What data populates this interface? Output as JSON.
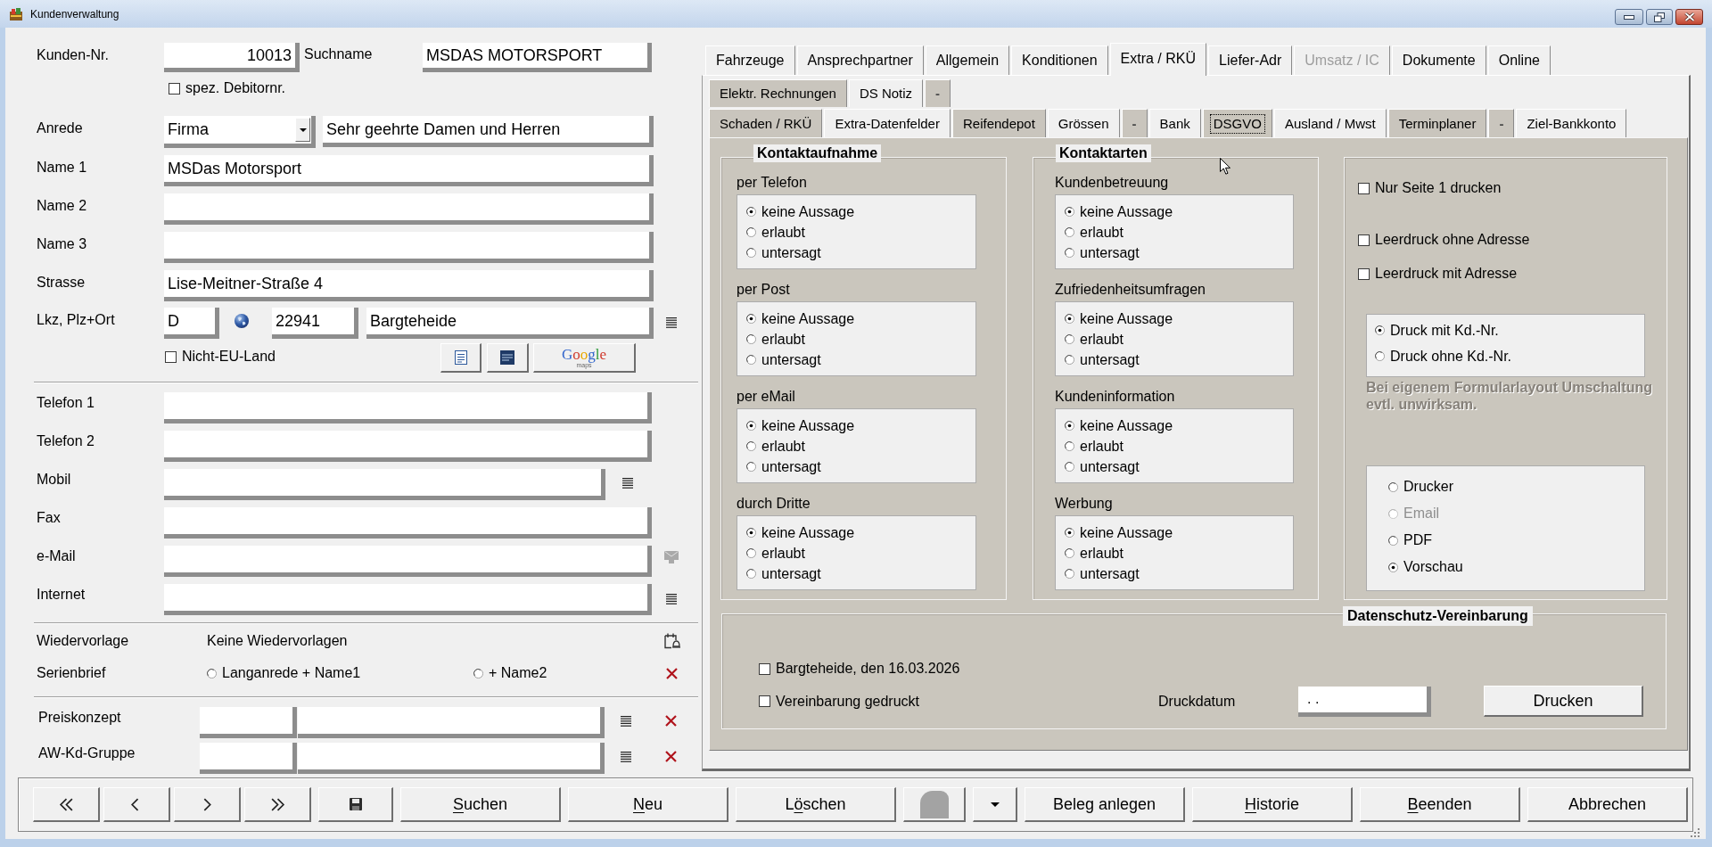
{
  "window": {
    "title": "Kundenverwaltung"
  },
  "customer": {
    "number": {
      "label": "Kunden-Nr.",
      "value": "10013"
    },
    "search_name": {
      "label": "Suchname",
      "value": "MSDAS MOTORSPORT"
    },
    "special_debtor": {
      "label": "spez. Debitornr.",
      "checked": false
    },
    "salutation": {
      "label": "Anrede",
      "value": "Firma",
      "greeting": "Sehr geehrte Damen und Herren"
    },
    "names": [
      {
        "label": "Name 1",
        "value": "MSDas Motorsport"
      },
      {
        "label": "Name 2"
      },
      {
        "label": "Name 3"
      }
    ],
    "street": {
      "label": "Strasse",
      "value": "Lise-Meitner-Straße 4"
    },
    "location": {
      "label": "Lkz, Plz+Ort",
      "country": "D",
      "zip": "22941",
      "city": "Bargteheide"
    },
    "non_eu": {
      "label": "Nicht-EU-Land",
      "checked": false
    },
    "maps_button": {
      "label": "Google",
      "sublabel": "maps"
    },
    "contacts": [
      {
        "label": "Telefon 1",
        "kind": "plain"
      },
      {
        "label": "Telefon 2",
        "kind": "plain"
      },
      {
        "label": "Mobil",
        "kind": "list-short"
      },
      {
        "label": "Fax",
        "kind": "plain"
      },
      {
        "label": "e-Mail",
        "kind": "mail"
      },
      {
        "label": "Internet",
        "kind": "list"
      }
    ],
    "follow_up": {
      "label": "Wiedervorlage",
      "value": "Keine Wiedervorlagen"
    },
    "serial_letter": {
      "label": "Serienbrief",
      "options": [
        {
          "label": "Langanrede + Name1",
          "selected": false
        },
        {
          "label": "+ Name2",
          "selected": false
        }
      ]
    },
    "lookups": [
      {
        "label": "Preiskonzept"
      },
      {
        "label": "AW-Kd-Gruppe"
      }
    ]
  },
  "tabs": [
    {
      "label": "Fahrzeuge",
      "selected": false,
      "disabled": false
    },
    {
      "label": "Ansprechpartner",
      "selected": false,
      "disabled": false
    },
    {
      "label": "Allgemein",
      "selected": false,
      "disabled": false
    },
    {
      "label": "Konditionen",
      "selected": false,
      "disabled": false
    },
    {
      "label": "Extra / RKÜ",
      "selected": true,
      "disabled": false
    },
    {
      "label": "Liefer-Adr",
      "selected": false,
      "disabled": false
    },
    {
      "label": "Umsatz / IC",
      "selected": false,
      "disabled": true
    },
    {
      "label": "Dokumente",
      "selected": false,
      "disabled": false
    },
    {
      "label": "Online",
      "selected": false,
      "disabled": false
    }
  ],
  "sub_tab_rows": [
    {
      "tabs": [
        {
          "label": "Elektr. Rechnungen",
          "selected": false,
          "highlighted": true,
          "disabled": false
        },
        {
          "label": "DS Notiz",
          "selected": false,
          "highlighted": false,
          "disabled": false
        },
        {
          "label": "-",
          "selected": false,
          "highlighted": true,
          "disabled": true
        }
      ]
    },
    {
      "tabs": [
        {
          "label": "Schaden / RKÜ",
          "selected": false,
          "highlighted": true,
          "disabled": false
        },
        {
          "label": "Extra-Datenfelder",
          "selected": false,
          "highlighted": false,
          "disabled": false
        },
        {
          "label": "Reifendepot",
          "selected": false,
          "highlighted": true,
          "disabled": false
        },
        {
          "label": "Grössen",
          "selected": false,
          "highlighted": false,
          "disabled": false
        },
        {
          "label": "-",
          "selected": false,
          "highlighted": true,
          "disabled": true
        },
        {
          "label": "Bank",
          "selected": false,
          "highlighted": false,
          "disabled": false
        },
        {
          "label": "DSGVO",
          "selected": true,
          "highlighted": false,
          "disabled": false
        },
        {
          "label": "Ausland / Mwst",
          "selected": false,
          "highlighted": false,
          "disabled": false
        },
        {
          "label": "Terminplaner",
          "selected": false,
          "highlighted": true,
          "disabled": false
        },
        {
          "label": "-",
          "selected": false,
          "highlighted": true,
          "disabled": true
        },
        {
          "label": "Ziel-Bankkonto",
          "selected": false,
          "highlighted": false,
          "disabled": false
        }
      ]
    }
  ],
  "dsgvo": {
    "contact_groups": [
      {
        "title": "Kontaktaufnahme",
        "sections": [
          {
            "label": "per Telefon",
            "options": [
              {
                "label": "keine Aussage",
                "selected": true
              },
              {
                "label": "erlaubt",
                "selected": false
              },
              {
                "label": "untersagt",
                "selected": false
              }
            ]
          },
          {
            "label": "per Post",
            "options": [
              {
                "label": "keine Aussage",
                "selected": true
              },
              {
                "label": "erlaubt",
                "selected": false
              },
              {
                "label": "untersagt",
                "selected": false
              }
            ]
          },
          {
            "label": "per eMail",
            "options": [
              {
                "label": "keine Aussage",
                "selected": true
              },
              {
                "label": "erlaubt",
                "selected": false
              },
              {
                "label": "untersagt",
                "selected": false
              }
            ]
          },
          {
            "label": "durch Dritte",
            "options": [
              {
                "label": "keine Aussage",
                "selected": true
              },
              {
                "label": "erlaubt",
                "selected": false
              },
              {
                "label": "untersagt",
                "selected": false
              }
            ]
          }
        ]
      },
      {
        "title": "Kontaktarten",
        "sections": [
          {
            "label": "Kundenbetreuung",
            "options": [
              {
                "label": "keine Aussage",
                "selected": true
              },
              {
                "label": "erlaubt",
                "selected": false
              },
              {
                "label": "untersagt",
                "selected": false
              }
            ]
          },
          {
            "label": "Zufriedenheitsumfragen",
            "options": [
              {
                "label": "keine Aussage",
                "selected": true
              },
              {
                "label": "erlaubt",
                "selected": false
              },
              {
                "label": "untersagt",
                "selected": false
              }
            ]
          },
          {
            "label": "Kundeninformation",
            "options": [
              {
                "label": "keine Aussage",
                "selected": true
              },
              {
                "label": "erlaubt",
                "selected": false
              },
              {
                "label": "untersagt",
                "selected": false
              }
            ]
          },
          {
            "label": "Werbung",
            "options": [
              {
                "label": "keine Aussage",
                "selected": true
              },
              {
                "label": "erlaubt",
                "selected": false
              },
              {
                "label": "untersagt",
                "selected": false
              }
            ]
          }
        ]
      }
    ],
    "print_options": {
      "checkboxes": [
        {
          "label": "Nur Seite 1 drucken",
          "checked": false
        },
        {
          "label": "Leerdruck ohne Adresse",
          "checked": false
        },
        {
          "label": "Leerdruck mit Adresse",
          "checked": false
        }
      ],
      "number_options": [
        {
          "label": "Druck mit Kd.-Nr.",
          "selected": true
        },
        {
          "label": "Druck ohne Kd.-Nr.",
          "selected": false
        }
      ],
      "note": "Bei eigenem Formularlayout Umschaltung evtl. unwirksam.",
      "output_options": [
        {
          "label": "Drucker",
          "selected": false,
          "disabled": false
        },
        {
          "label": "Email",
          "selected": false,
          "disabled": true
        },
        {
          "label": "PDF",
          "selected": false,
          "disabled": false
        },
        {
          "label": "Vorschau",
          "selected": true,
          "disabled": false
        }
      ]
    },
    "agreement": {
      "title": "Datenschutz-Vereinbarung",
      "checkboxes": [
        {
          "label": "Bargteheide, den 16.03.2026",
          "checked": false
        },
        {
          "label": "Vereinbarung gedruckt",
          "checked": false
        }
      ],
      "print_date_label": "Druckdatum",
      "print_date": ". .",
      "print_button": "Drucken"
    }
  },
  "toolbar": {
    "buttons": [
      {
        "kind": "first"
      },
      {
        "kind": "previous"
      },
      {
        "kind": "next"
      },
      {
        "kind": "last"
      },
      {
        "kind": "save"
      },
      {
        "kind": "text",
        "label": [
          {
            "text": "S",
            "underline": true
          },
          {
            "text": "uchen",
            "underline": false
          }
        ]
      },
      {
        "kind": "text",
        "label": [
          {
            "text": "N",
            "underline": true
          },
          {
            "text": "eu",
            "underline": false
          }
        ]
      },
      {
        "kind": "text",
        "label": [
          {
            "text": "L",
            "underline": false
          },
          {
            "text": "ö",
            "underline": true
          },
          {
            "text": "schen",
            "underline": false
          }
        ]
      },
      {
        "kind": "photo"
      },
      {
        "kind": "menu"
      },
      {
        "kind": "text",
        "label": [
          {
            "text": "Beleg anlegen",
            "underline": false
          }
        ]
      },
      {
        "kind": "text",
        "label": [
          {
            "text": "H",
            "underline": true
          },
          {
            "text": "istorie",
            "underline": false
          }
        ]
      },
      {
        "kind": "text",
        "label": [
          {
            "text": "B",
            "underline": true
          },
          {
            "text": "eenden",
            "underline": false
          }
        ]
      },
      {
        "kind": "text",
        "label": [
          {
            "text": "Abbrechen",
            "underline": false
          }
        ]
      }
    ]
  }
}
